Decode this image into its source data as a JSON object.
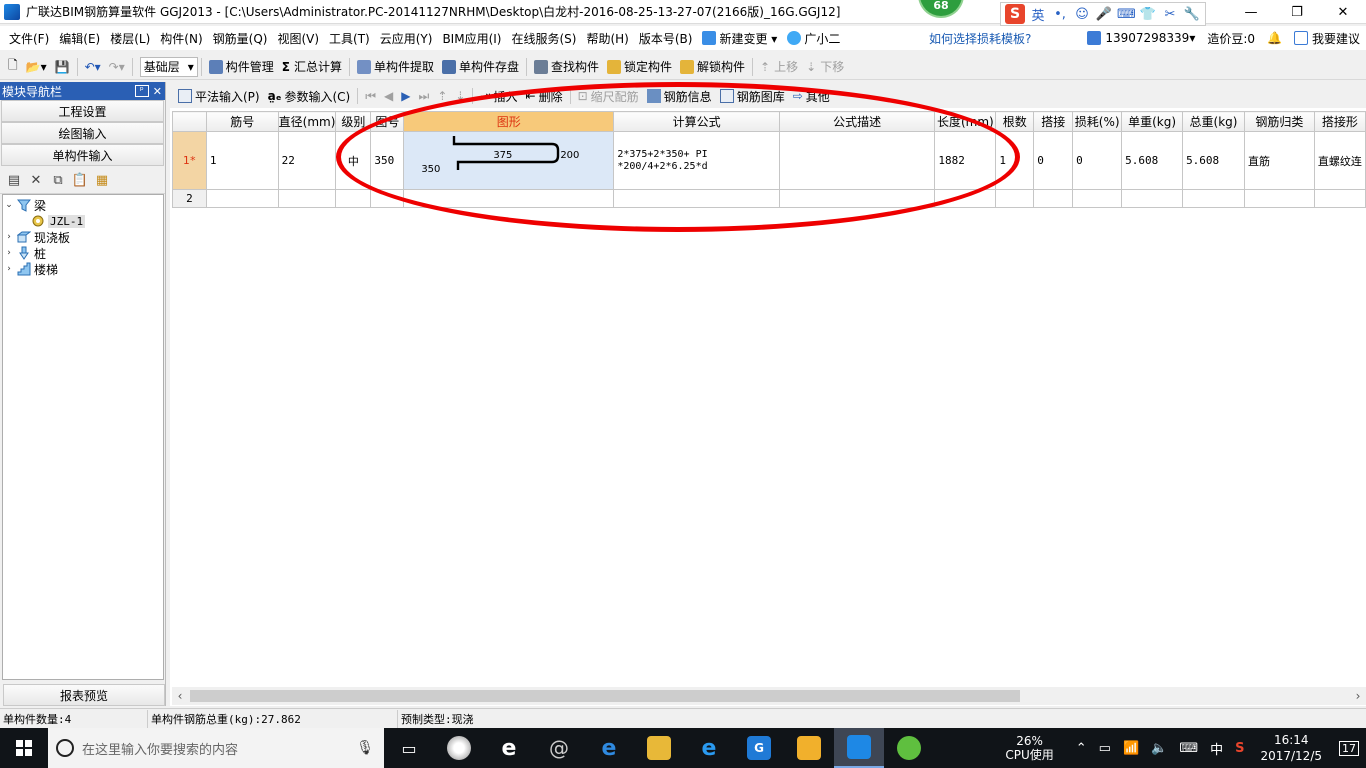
{
  "window": {
    "title": "广联达BIM钢筋算量软件 GGJ2013 - [C:\\Users\\Administrator.PC-20141127NRHM\\Desktop\\白龙村-2016-08-25-13-27-07(2166版)_16G.GGJ12]",
    "score_badge": "68",
    "controls": [
      "—",
      "❐",
      "✕"
    ]
  },
  "ime": {
    "logo": "S",
    "items": [
      "英",
      "•,",
      "☺",
      "🎤",
      "⌨",
      "👕",
      "✂",
      "🔧"
    ]
  },
  "menu": {
    "items": [
      "文件(F)",
      "编辑(E)",
      "楼层(L)",
      "构件(N)",
      "钢筋量(Q)",
      "视图(V)",
      "工具(T)",
      "云应用(Y)",
      "BIM应用(I)",
      "在线服务(S)",
      "帮助(H)",
      "版本号(B)"
    ],
    "new_change": "新建变更",
    "assistant": "广小二",
    "help_link": "如何选择损耗模板?",
    "phone": "13907298339",
    "coins": "造价豆:0",
    "suggest": "我要建议"
  },
  "toolbar": {
    "layer": "基础层",
    "component_mgmt": "构件管理",
    "summary_calc": "汇总计算",
    "extract": "单构件提取",
    "save_disk": "单构件存盘",
    "find": "查找构件",
    "lock": "锁定构件",
    "unlock": "解锁构件",
    "move_up": "上移",
    "move_down": "下移"
  },
  "nav": {
    "header": "模块导航栏",
    "header_btns": [
      "ᵖ",
      "✕"
    ],
    "sections": [
      "工程设置",
      "绘图输入",
      "单构件输入"
    ],
    "report_preview": "报表预览",
    "tree": [
      {
        "label": "梁",
        "expanded": true,
        "level": 0
      },
      {
        "label": "JZL-1",
        "level": 1,
        "selected": true
      },
      {
        "label": "现浇板",
        "level": 0
      },
      {
        "label": "桩",
        "level": 0
      },
      {
        "label": "楼梯",
        "level": 0
      }
    ]
  },
  "grid_toolbar": {
    "flat_input": "平法输入(P)",
    "param_input": "参数输入(C)",
    "insert": "插入",
    "delete": "删除",
    "scale_rebar": "缩尺配筋",
    "rebar_info": "钢筋信息",
    "rebar_library": "钢筋图库",
    "other": "其他"
  },
  "grid": {
    "headers": [
      "筋号",
      "直径(mm)",
      "级别",
      "图号",
      "图形",
      "计算公式",
      "公式描述",
      "长度(mm)",
      "根数",
      "搭接",
      "损耗(%)",
      "单重(kg)",
      "总重(kg)",
      "钢筋归类",
      "搭接形"
    ],
    "rows": [
      {
        "row_label": "1*",
        "bar_no": "1",
        "diameter": "22",
        "grade": "中",
        "shape_no": "350",
        "shape": {
          "top": "375",
          "right": "200",
          "left": "350"
        },
        "formula": "2*375+2*350+ PI *200/4+2*6.25*d",
        "desc": "",
        "length": "1882",
        "count": "1",
        "lap": "0",
        "loss": "0",
        "unit_weight": "5.608",
        "total_weight": "5.608",
        "category": "直筋",
        "lap_type": "直螺纹连"
      },
      {
        "row_label": "2"
      }
    ]
  },
  "status": {
    "count": "单构件数量:4",
    "total_weight": "单构件钢筋总重(kg):27.862",
    "type": "预制类型:现浇"
  },
  "taskbar": {
    "search_placeholder": "在这里输入你要搜索的内容",
    "cpu_percent": "26%",
    "cpu_label": "CPU使用",
    "lang": "中",
    "time": "16:14",
    "date": "2017/12/5",
    "notif_count": "17"
  }
}
